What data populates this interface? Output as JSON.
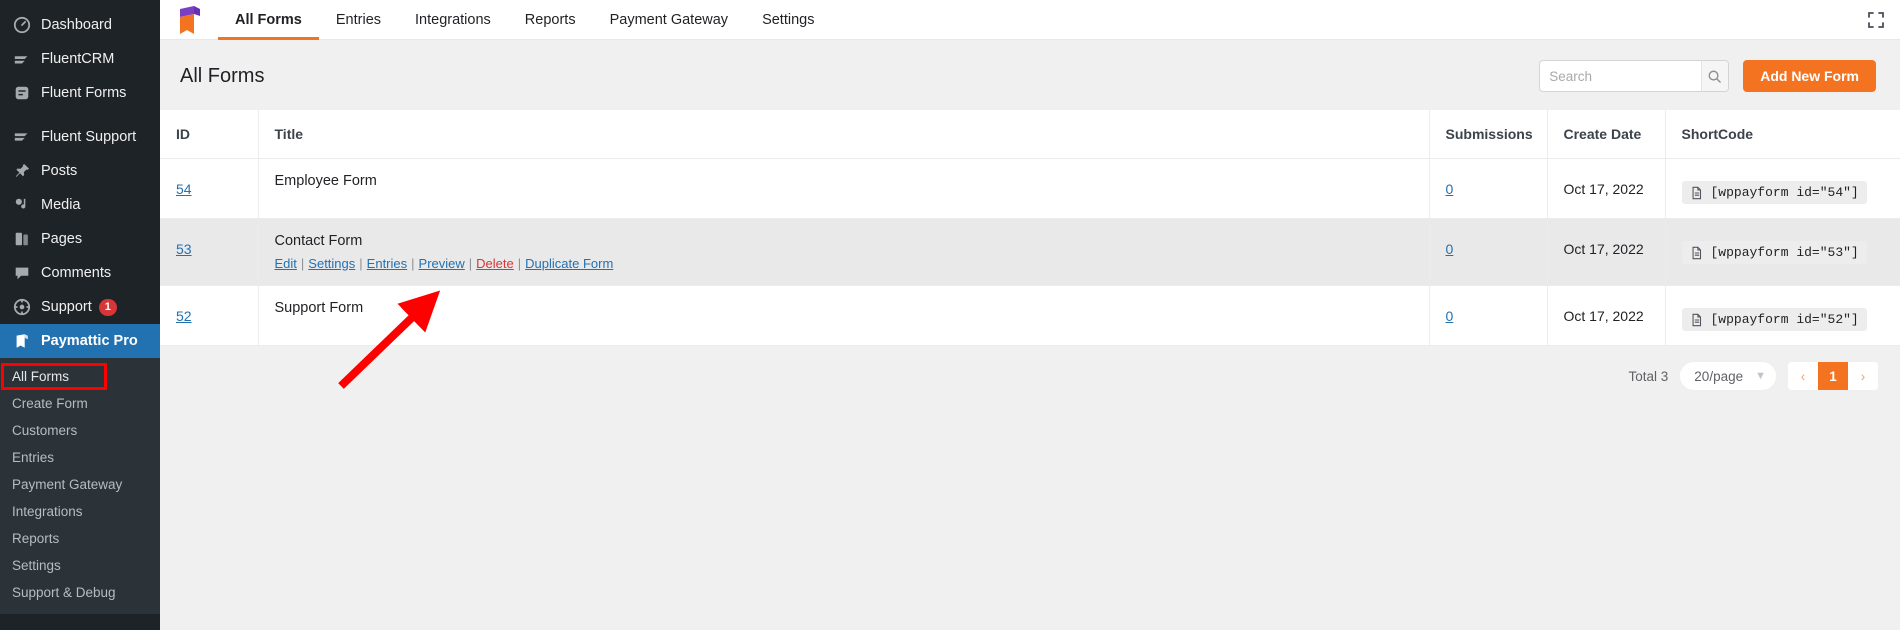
{
  "sidebar": {
    "items": [
      {
        "label": "Dashboard",
        "icon": "dashboard-icon",
        "badge": null,
        "active": false
      },
      {
        "label": "FluentCRM",
        "icon": "fluentcrm-icon",
        "badge": null,
        "active": false
      },
      {
        "label": "Fluent Forms",
        "icon": "fluent-forms-icon",
        "badge": null,
        "active": false
      },
      {
        "label": "Fluent Support",
        "icon": "fluent-support-icon",
        "badge": null,
        "active": false
      },
      {
        "label": "Posts",
        "icon": "pin-icon",
        "badge": null,
        "active": false
      },
      {
        "label": "Media",
        "icon": "media-icon",
        "badge": null,
        "active": false
      },
      {
        "label": "Pages",
        "icon": "pages-icon",
        "badge": null,
        "active": false
      },
      {
        "label": "Comments",
        "icon": "comment-icon",
        "badge": null,
        "active": false
      },
      {
        "label": "Support",
        "icon": "support-icon",
        "badge": "1",
        "active": false
      },
      {
        "label": "Paymattic Pro",
        "icon": "paymattic-icon",
        "badge": null,
        "active": true
      }
    ],
    "submenu": [
      {
        "label": "All Forms",
        "current": true,
        "highlighted": true
      },
      {
        "label": "Create Form",
        "current": false,
        "highlighted": false
      },
      {
        "label": "Customers",
        "current": false,
        "highlighted": false
      },
      {
        "label": "Entries",
        "current": false,
        "highlighted": false
      },
      {
        "label": "Payment Gateway",
        "current": false,
        "highlighted": false
      },
      {
        "label": "Integrations",
        "current": false,
        "highlighted": false
      },
      {
        "label": "Reports",
        "current": false,
        "highlighted": false
      },
      {
        "label": "Settings",
        "current": false,
        "highlighted": false
      },
      {
        "label": "Support & Debug",
        "current": false,
        "highlighted": false
      }
    ]
  },
  "topnav": {
    "logo_name": "paymattic-logo",
    "tabs": [
      {
        "label": "All Forms",
        "active": true
      },
      {
        "label": "Entries",
        "active": false
      },
      {
        "label": "Integrations",
        "active": false
      },
      {
        "label": "Reports",
        "active": false
      },
      {
        "label": "Payment Gateway",
        "active": false
      },
      {
        "label": "Settings",
        "active": false
      }
    ],
    "fullscreen_icon": "fullscreen-icon"
  },
  "header": {
    "title": "All Forms",
    "search": {
      "value": "",
      "placeholder": "Search",
      "icon": "search-icon"
    },
    "add_button": "Add New Form"
  },
  "table": {
    "columns": [
      "ID",
      "Title",
      "Submissions",
      "Create Date",
      "ShortCode"
    ],
    "rows": [
      {
        "id": "54",
        "title": "Employee Form",
        "submissions": "0",
        "create_date": "Oct 17, 2022",
        "shortcode": "[wppayform id=\"54\"]",
        "hovered": false,
        "actions": []
      },
      {
        "id": "53",
        "title": "Contact Form",
        "submissions": "0",
        "create_date": "Oct 17, 2022",
        "shortcode": "[wppayform id=\"53\"]",
        "hovered": true,
        "actions": [
          {
            "label": "Edit",
            "danger": false
          },
          {
            "label": "Settings",
            "danger": false
          },
          {
            "label": "Entries",
            "danger": false
          },
          {
            "label": "Preview",
            "danger": false
          },
          {
            "label": "Delete",
            "danger": true
          },
          {
            "label": "Duplicate Form",
            "danger": false
          }
        ]
      },
      {
        "id": "52",
        "title": "Support Form",
        "submissions": "0",
        "create_date": "Oct 17, 2022",
        "shortcode": "[wppayform id=\"52\"]",
        "hovered": false,
        "actions": []
      }
    ]
  },
  "pagination": {
    "total": "Total 3",
    "per_page": "20/page",
    "prev": "‹",
    "next": "›",
    "pages": [
      "1"
    ],
    "current_page": "1"
  },
  "annotation": {
    "type": "arrow",
    "color": "#ff0000",
    "points_to": "Entries"
  },
  "colors": {
    "accent": "#f47321",
    "link": "#2271b1",
    "danger": "#d63638",
    "sidebar_bg": "#1d2327",
    "submenu_bg": "#2c3338",
    "active_menu": "#2271b1"
  }
}
